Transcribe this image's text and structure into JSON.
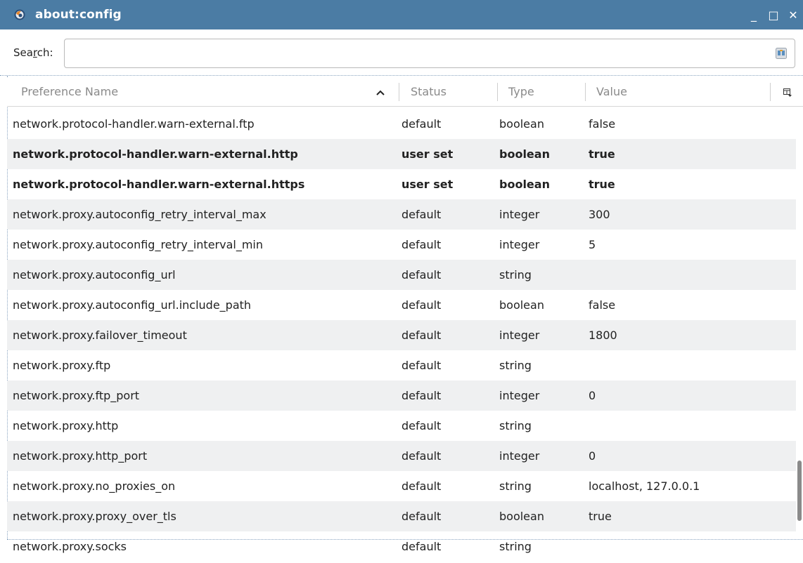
{
  "window": {
    "title": "about:config",
    "controls": {
      "minimize": "_",
      "maximize": "□",
      "close": "✕"
    }
  },
  "search": {
    "label_prefix": "Sea",
    "label_accel": "r",
    "label_suffix": "ch:",
    "value": "",
    "placeholder": ""
  },
  "table": {
    "columns": [
      "Preference Name",
      "Status",
      "Type",
      "Value"
    ],
    "sort_indicator": "^",
    "rows": [
      {
        "name": "network.protocol-handler.warn-external.ftp",
        "status": "default",
        "type": "boolean",
        "value": "false",
        "bold": false
      },
      {
        "name": "network.protocol-handler.warn-external.http",
        "status": "user set",
        "type": "boolean",
        "value": "true",
        "bold": true
      },
      {
        "name": "network.protocol-handler.warn-external.https",
        "status": "user set",
        "type": "boolean",
        "value": "true",
        "bold": true
      },
      {
        "name": "network.proxy.autoconfig_retry_interval_max",
        "status": "default",
        "type": "integer",
        "value": "300",
        "bold": false
      },
      {
        "name": "network.proxy.autoconfig_retry_interval_min",
        "status": "default",
        "type": "integer",
        "value": "5",
        "bold": false
      },
      {
        "name": "network.proxy.autoconfig_url",
        "status": "default",
        "type": "string",
        "value": "",
        "bold": false
      },
      {
        "name": "network.proxy.autoconfig_url.include_path",
        "status": "default",
        "type": "boolean",
        "value": "false",
        "bold": false
      },
      {
        "name": "network.proxy.failover_timeout",
        "status": "default",
        "type": "integer",
        "value": "1800",
        "bold": false
      },
      {
        "name": "network.proxy.ftp",
        "status": "default",
        "type": "string",
        "value": "",
        "bold": false
      },
      {
        "name": "network.proxy.ftp_port",
        "status": "default",
        "type": "integer",
        "value": "0",
        "bold": false
      },
      {
        "name": "network.proxy.http",
        "status": "default",
        "type": "string",
        "value": "",
        "bold": false
      },
      {
        "name": "network.proxy.http_port",
        "status": "default",
        "type": "integer",
        "value": "0",
        "bold": false
      },
      {
        "name": "network.proxy.no_proxies_on",
        "status": "default",
        "type": "string",
        "value": "localhost, 127.0.0.1",
        "bold": false
      },
      {
        "name": "network.proxy.proxy_over_tls",
        "status": "default",
        "type": "boolean",
        "value": "true",
        "bold": false
      },
      {
        "name": "network.proxy.socks",
        "status": "default",
        "type": "string",
        "value": "",
        "bold": false
      }
    ]
  },
  "icons": {
    "app": "firefox-icon",
    "search": "search-clear-icon",
    "column_picker": "column-picker-icon"
  },
  "colors": {
    "titlebar": "#4b7ca4",
    "row_alt": "#eff0f1",
    "header_text": "#8a8a8a"
  }
}
